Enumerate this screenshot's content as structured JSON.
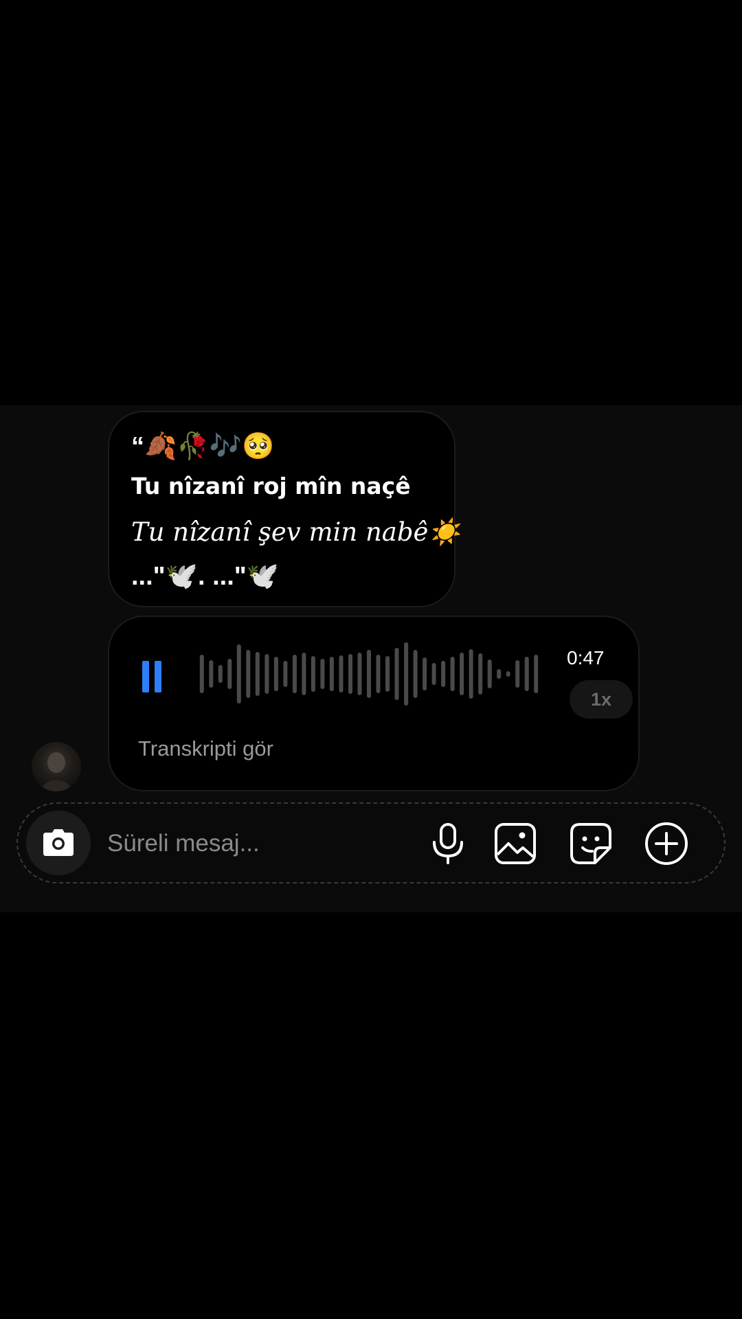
{
  "message": {
    "line1": "“🍂🥀🎶🥺",
    "line2": "Tu nîzanî roj mîn naçê",
    "line3": "Tu nîzanî şev min nabê☀️",
    "line4": "...\"🕊️.          ...\"🕊️"
  },
  "voice_message": {
    "state": "playing",
    "duration": "0:47",
    "speed": "1x",
    "transcript_link": "Transkripti gör",
    "accent_color": "#2d7ff9"
  },
  "composer": {
    "placeholder": "Süreli mesaj...",
    "icons": [
      "camera-icon",
      "microphone-icon",
      "gallery-icon",
      "sticker-icon",
      "plus-circle-icon"
    ]
  }
}
